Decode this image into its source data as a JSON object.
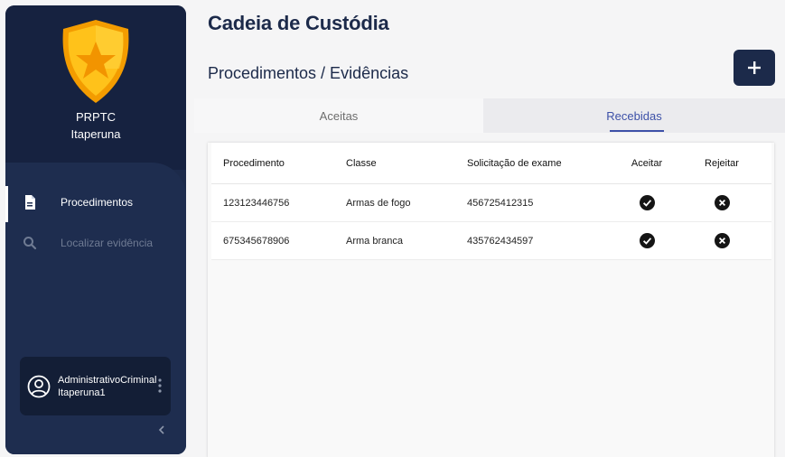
{
  "sidebar": {
    "org_line1": "PRPTC",
    "org_line2": "Itaperuna",
    "nav": [
      {
        "label": "Procedimentos",
        "icon": "document-icon"
      },
      {
        "label": "Localizar evidência",
        "icon": "search-icon"
      }
    ],
    "user": {
      "name": "AdministrativoCriminalItaperuna1"
    }
  },
  "header": {
    "title": "Cadeia de Custódia",
    "subtitle": "Procedimentos / Evidências"
  },
  "tabs": [
    {
      "label": "Aceitas",
      "active": false
    },
    {
      "label": "Recebidas",
      "active": true
    }
  ],
  "table": {
    "columns": [
      "Procedimento",
      "Classe",
      "Solicitação de exame",
      "Aceitar",
      "Rejeitar"
    ],
    "rows": [
      {
        "procedimento": "123123446756",
        "classe": "Armas de fogo",
        "solicitacao": "456725412315"
      },
      {
        "procedimento": "675345678906",
        "classe": "Arma branca",
        "solicitacao": "435762434597"
      }
    ]
  },
  "colors": {
    "navy": "#1c2a4a",
    "accent": "#3d51a8",
    "badge": "#f6b100"
  }
}
